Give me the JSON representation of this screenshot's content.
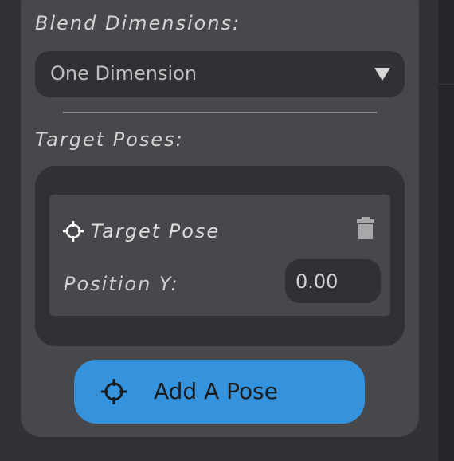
{
  "blend": {
    "label": "Blend Dimensions:",
    "dropdown_value": "One Dimension"
  },
  "targets": {
    "label": "Target Poses:",
    "pose": {
      "title": "Target Pose",
      "field_label": "Position Y:",
      "value": "0.00"
    }
  },
  "add_button": {
    "label": "Add A Pose"
  },
  "colors": {
    "panel": "#47484c",
    "dark": "#303135",
    "accent": "#3593de"
  },
  "icons": {
    "dropdown": "chevron-down-icon",
    "pose": "target-icon",
    "delete": "trash-icon",
    "add": "target-icon"
  }
}
